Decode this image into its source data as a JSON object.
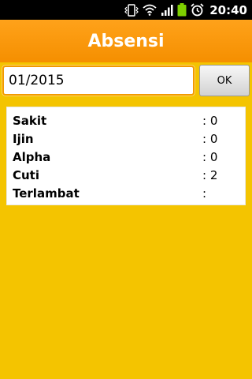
{
  "status_bar": {
    "time": "20:40",
    "icons": [
      "vibrate-icon",
      "wifi-icon",
      "signal-icon",
      "battery-icon",
      "alarm-icon"
    ]
  },
  "app": {
    "title": "Absensi"
  },
  "form": {
    "date_value": "01/2015",
    "ok_label": "OK"
  },
  "summary": {
    "rows": [
      {
        "label": "Sakit",
        "value": ": 0"
      },
      {
        "label": "Ijin",
        "value": ": 0"
      },
      {
        "label": "Alpha",
        "value": ": 0"
      },
      {
        "label": "Cuti",
        "value": ": 2"
      },
      {
        "label": "Terlambat",
        "value": ":"
      }
    ]
  },
  "colors": {
    "background": "#f4c400",
    "title_bar": "#f7960a",
    "input_border": "#f29b00"
  }
}
